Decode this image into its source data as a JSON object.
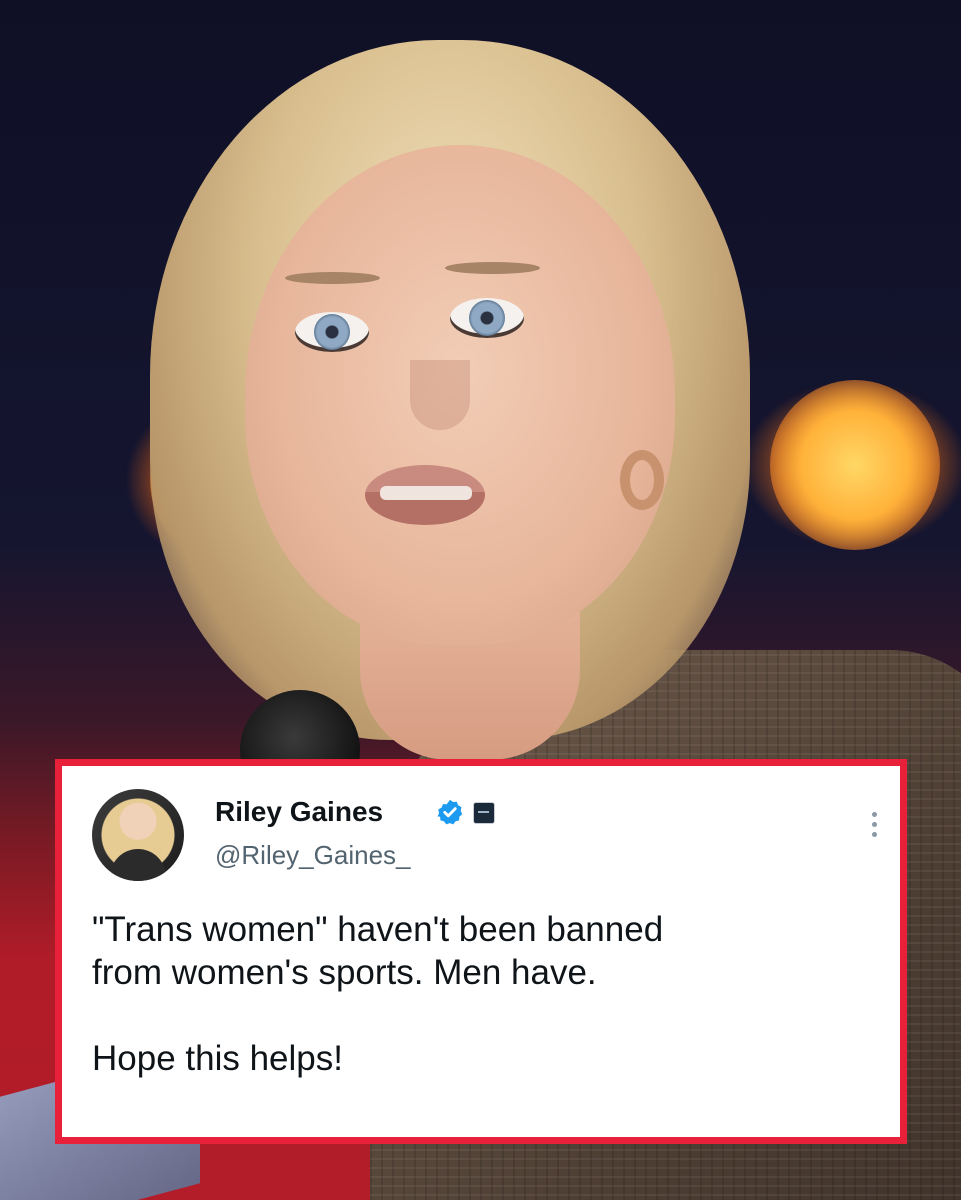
{
  "tweet": {
    "display_name": "Riley Gaines",
    "handle": "@Riley_Gaines_",
    "text_line_1": "\"Trans women\" haven't been banned",
    "text_line_2": "from women's sports. Men have.",
    "text_line_3": "Hope this helps!",
    "verified_icon": "verified-badge-icon",
    "affiliate_icon": "affiliation-badge-icon",
    "more_icon": "more-options-icon"
  },
  "colors": {
    "card_border": "#e8203a",
    "verified_blue": "#1d9bf0",
    "text_primary": "#0f1419",
    "text_secondary": "#536471"
  }
}
